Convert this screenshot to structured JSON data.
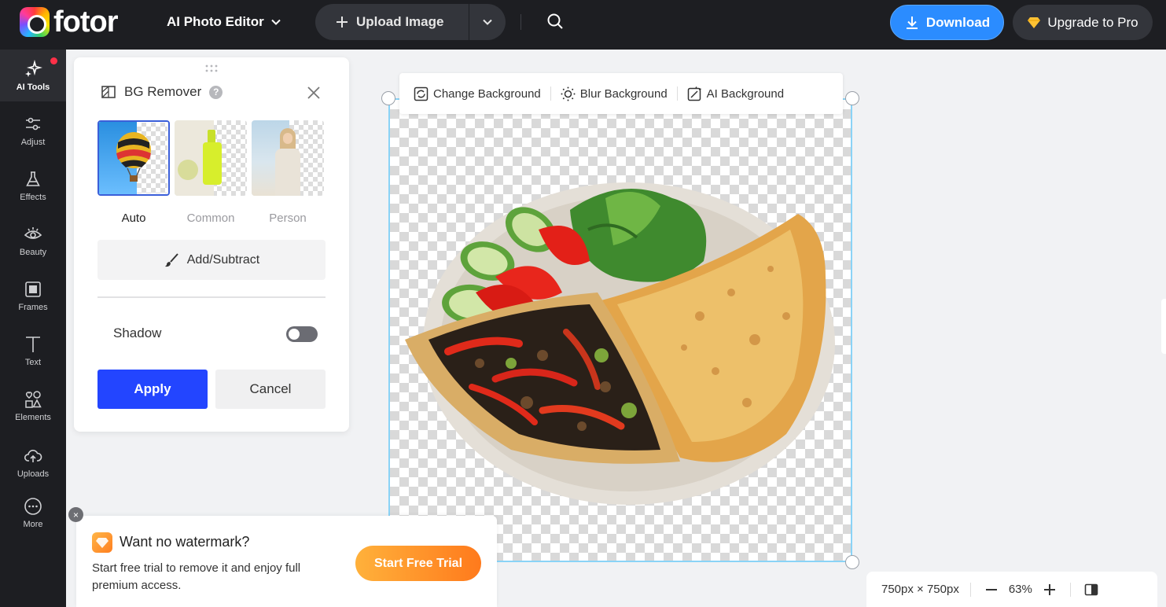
{
  "app": {
    "logo_text": "fotor"
  },
  "topbar": {
    "editor_menu": "AI Photo Editor",
    "upload_label": "Upload Image",
    "download_label": "Download",
    "upgrade_label": "Upgrade to Pro"
  },
  "sidebar": {
    "items": [
      {
        "label": "AI Tools",
        "icon": "sparkles-icon"
      },
      {
        "label": "Adjust",
        "icon": "sliders-icon"
      },
      {
        "label": "Effects",
        "icon": "flask-icon"
      },
      {
        "label": "Beauty",
        "icon": "eye-icon"
      },
      {
        "label": "Frames",
        "icon": "frame-icon"
      },
      {
        "label": "Text",
        "icon": "text-icon"
      },
      {
        "label": "Elements",
        "icon": "shapes-icon"
      },
      {
        "label": "Uploads",
        "icon": "cloud-upload-icon"
      },
      {
        "label": "More",
        "icon": "more-icon"
      }
    ]
  },
  "panel": {
    "title": "BG Remover",
    "modes": [
      {
        "label": "Auto",
        "selected": true
      },
      {
        "label": "Common",
        "selected": false
      },
      {
        "label": "Person",
        "selected": false
      }
    ],
    "add_subtract": "Add/Subtract",
    "shadow_label": "Shadow",
    "shadow_on": false,
    "apply": "Apply",
    "cancel": "Cancel"
  },
  "canvas_toolbar": {
    "change_bg": "Change Background",
    "blur_bg": "Blur Background",
    "ai_bg": "AI Background"
  },
  "promo": {
    "title": "Want no watermark?",
    "text": "Start free trial to remove it and enjoy full premium access.",
    "cta": "Start Free Trial",
    "close": "×"
  },
  "status": {
    "dimensions": "750px × 750px",
    "zoom": "63%"
  },
  "colors": {
    "accent_blue": "#2345ff",
    "download_blue": "#2b8cff",
    "trial_orange": "#ff7a1c",
    "selection_border": "#8ad3f6"
  }
}
